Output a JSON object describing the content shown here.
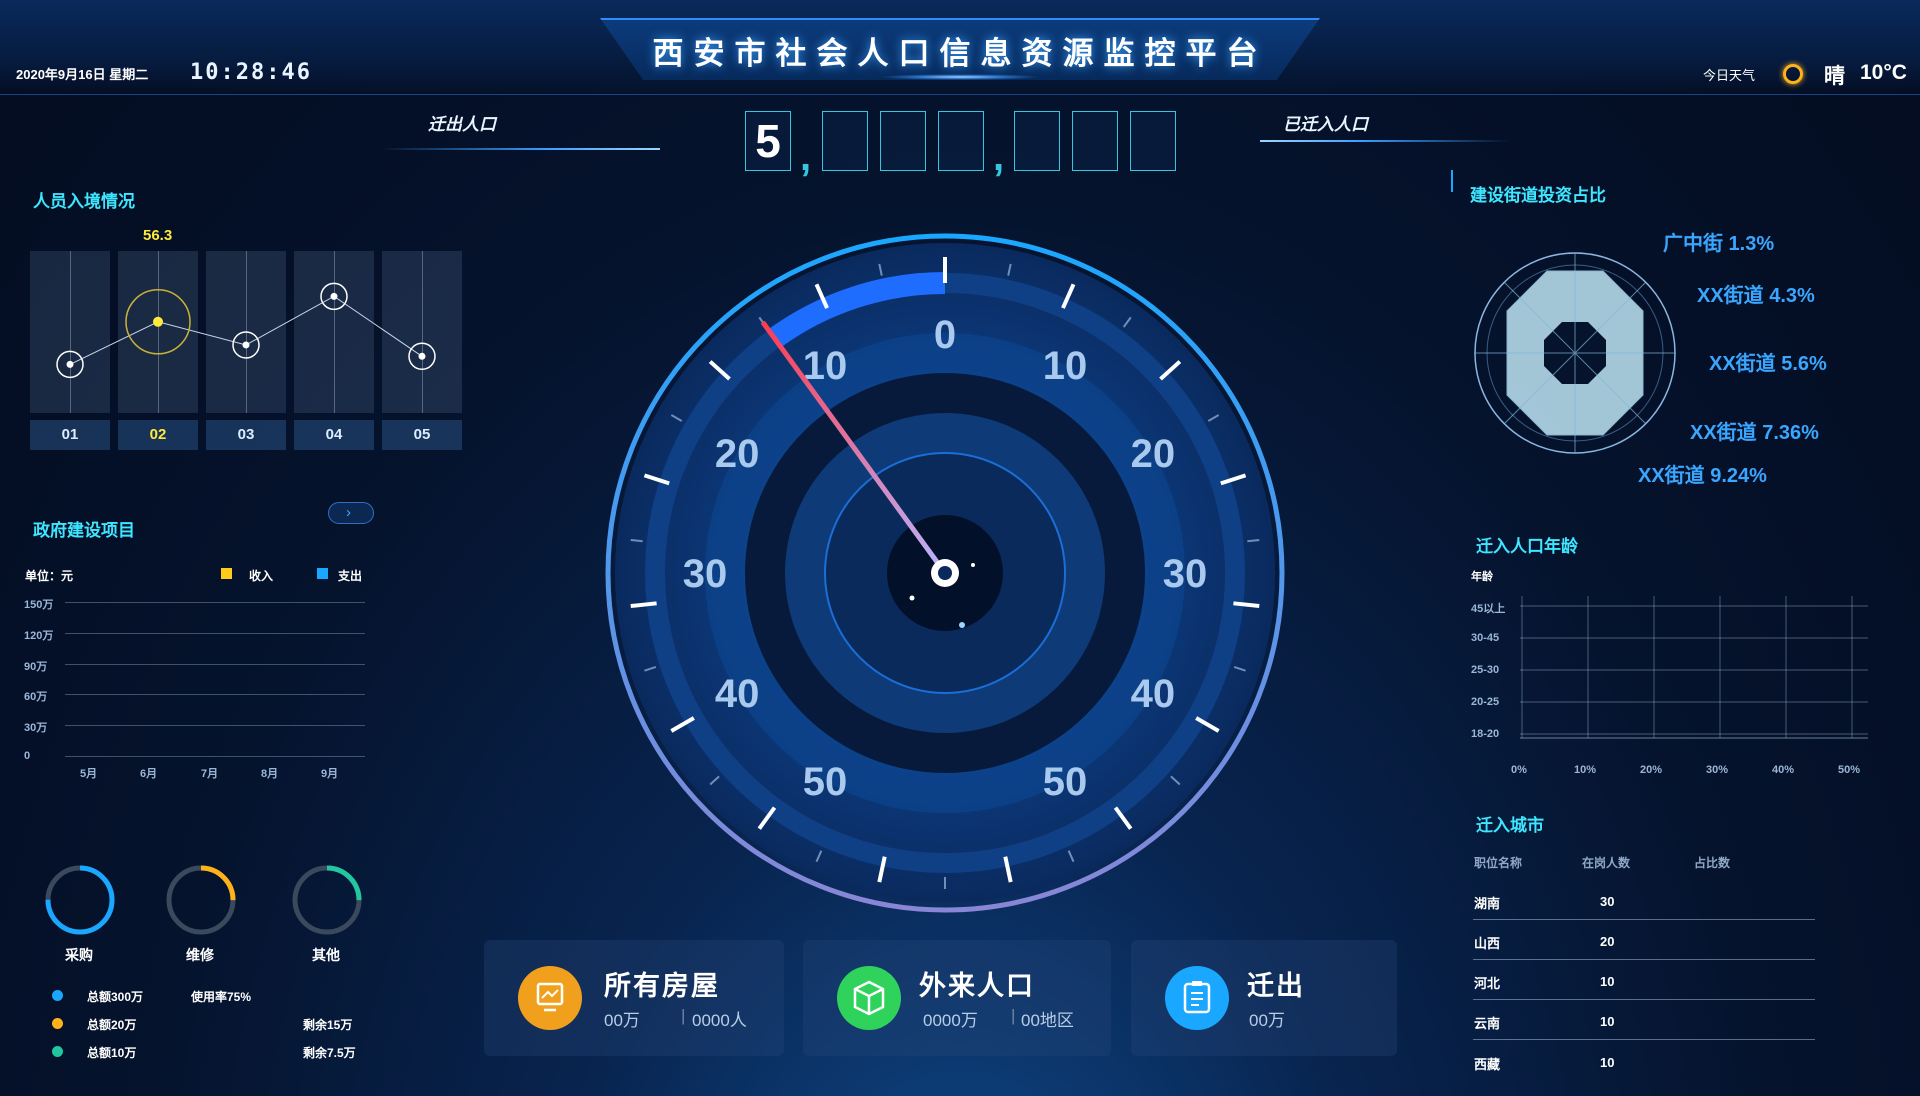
{
  "header": {
    "title": "西安市社会人口信息资源监控平台",
    "date": "2020年9月16日 星期二",
    "time": "10:28:46",
    "weather_label": "今日天气",
    "weather_condition": "晴",
    "weather_temp": "10°C"
  },
  "population": {
    "out_label": "迁出人口",
    "in_label": "已迁入人口",
    "digits": [
      "5",
      "",
      "",
      "",
      "",
      "",
      ""
    ],
    "separators": [
      ",",
      ","
    ]
  },
  "entry_panel": {
    "title": "人员入境情况",
    "highlight_value": "56.3",
    "columns": [
      "01",
      "02",
      "03",
      "04",
      "05"
    ],
    "active_index": 1,
    "values": [
      30,
      56.3,
      42,
      72,
      35
    ]
  },
  "projects_panel": {
    "title": "政府建设项目",
    "next_icon": "chevron-right-icon",
    "unit": "单位：元",
    "legend_income": "收入",
    "legend_expense": "支出",
    "y_ticks": [
      "150万",
      "120万",
      "90万",
      "60万",
      "30万",
      "0"
    ],
    "x_ticks": [
      "5月",
      "6月",
      "7月",
      "8月",
      "9月"
    ]
  },
  "rings": {
    "items": [
      {
        "label": "采购",
        "color": "#1aa7ff",
        "percent": 75
      },
      {
        "label": "维修",
        "color": "#ffb21a",
        "percent": 25
      },
      {
        "label": "其他",
        "color": "#22c7a0",
        "percent": 25
      }
    ],
    "legend": [
      {
        "total": "总额300万",
        "extra": "使用率75%",
        "color": "#1aa7ff"
      },
      {
        "total": "总额20万",
        "extra": "剩余15万",
        "color": "#ffb21a"
      },
      {
        "total": "总额10万",
        "extra": "剩余7.5万",
        "color": "#22c7a0"
      }
    ]
  },
  "gauge": {
    "labels_left": [
      "10",
      "20",
      "30",
      "40",
      "50"
    ],
    "labels_right": [
      "10",
      "20",
      "30",
      "40",
      "50"
    ],
    "top_label": "0",
    "needle_value": 12
  },
  "cards": [
    {
      "title": "所有房屋",
      "sub1": "00万",
      "sub2": "0000人",
      "color": "#f0a01c"
    },
    {
      "title": "外来人口",
      "sub1": "0000万",
      "sub2": "00地区",
      "color": "#2fd25a"
    },
    {
      "title": "迁出",
      "sub1": "00万",
      "sub2": "",
      "color": "#1aa7ff"
    }
  ],
  "investment": {
    "title": "建设街道投资占比",
    "items": [
      "广中街 1.3%",
      "XX街道 4.3%",
      "XX街道 5.6%",
      "XX街道 7.36%",
      "XX街道 9.24%"
    ]
  },
  "age_panel": {
    "title": "迁入人口年龄",
    "y_title": "年龄",
    "y_ticks": [
      "45以上",
      "30-45",
      "25-30",
      "20-25",
      "18-20"
    ],
    "x_ticks": [
      "0%",
      "10%",
      "20%",
      "30%",
      "40%",
      "50%"
    ]
  },
  "city_panel": {
    "title": "迁入城市",
    "headers": [
      "职位名称",
      "在岗人数",
      "占比数"
    ],
    "rows": [
      {
        "city": "湖南",
        "count": "30"
      },
      {
        "city": "山西",
        "count": "20"
      },
      {
        "city": "河北",
        "count": "10"
      },
      {
        "city": "云南",
        "count": "10"
      },
      {
        "city": "西藏",
        "count": "10"
      }
    ]
  }
}
